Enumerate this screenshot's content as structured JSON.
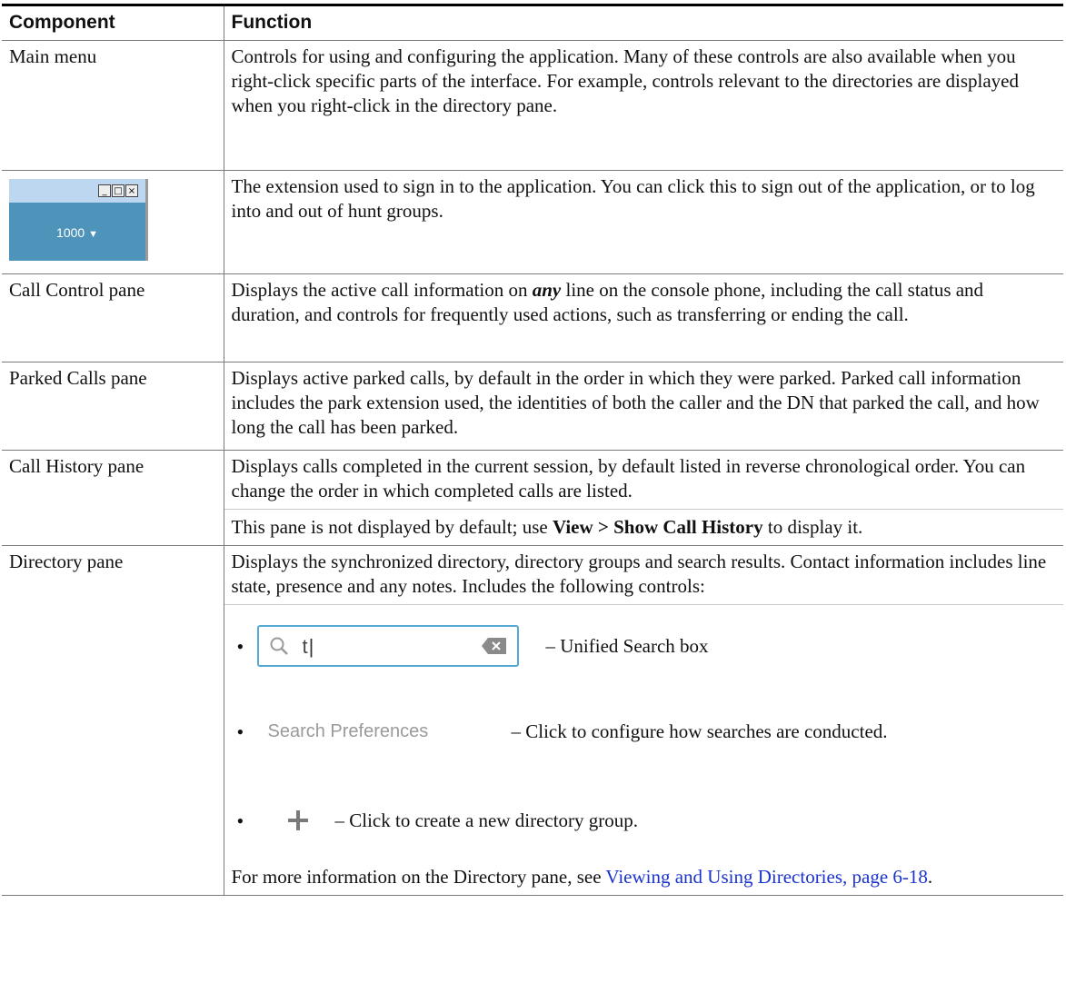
{
  "header": {
    "col1": "Component",
    "col2": "Function"
  },
  "rows": {
    "main_menu": {
      "label": "Main menu",
      "text": "Controls for using and configuring the application. Many of these controls are also available when you right-click specific parts of the interface. For example, controls relevant to the directories are displayed when you right-click in the directory pane."
    },
    "extension": {
      "thumb_value": "1000",
      "thumb_arrow": "▼",
      "text": "The extension used to sign in to the application. You can click this to sign out of the application, or to log into and out of hunt groups."
    },
    "call_control": {
      "label": "Call Control pane",
      "text_a": "Displays the active call information on ",
      "text_emph": "any",
      "text_b": " line on the console phone, including the call status and duration, and controls for frequently used actions, such as transferring or ending the call."
    },
    "parked": {
      "label": "Parked Calls pane",
      "text": "Displays active parked calls, by default in the order in which they were parked. Parked call information includes the park extension used, the identities of both the caller and the DN that parked the call, and how long the call has been parked."
    },
    "history": {
      "label": "Call History pane",
      "text1": "Displays calls completed in the current session, by default listed in reverse chronological order. You can change the order in which completed calls are listed.",
      "text2_a": "This pane is not displayed by default; use ",
      "text2_bold": "View > Show Call History",
      "text2_b": " to display it."
    },
    "directory": {
      "label": "Directory pane",
      "text": "Displays the synchronized directory, directory groups and search results. Contact information includes line state, presence and any notes. Includes the following controls:",
      "bullet_char": "•",
      "search_value": "t",
      "search_desc": "– Unified Search box",
      "pref_label": "Search Preferences",
      "pref_desc": "– Click to configure how searches are conducted.",
      "plus_desc": "– Click to create a new directory group.",
      "more_a": "For more information on the Directory pane, see ",
      "more_link": "Viewing and Using Directories, page 6-18",
      "more_b": "."
    }
  },
  "colors": {
    "link": "#1a33cc",
    "search_border": "#57a9d4",
    "thumb_blue": "#4e93b9"
  }
}
